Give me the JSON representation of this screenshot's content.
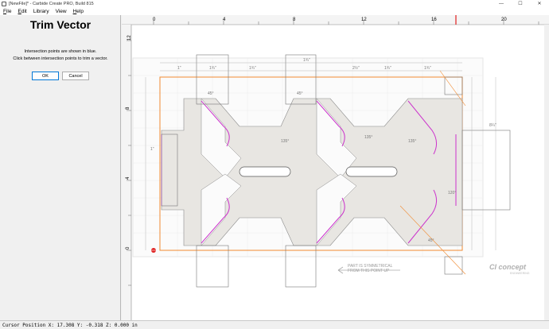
{
  "window": {
    "title": "[NewFile]* - Carbide Create PRO, Build 815",
    "minimize": "—",
    "maximize": "☐",
    "close": "✕"
  },
  "menu": [
    {
      "label": "File",
      "accel": "F",
      "rest": "ile"
    },
    {
      "label": "Edit",
      "accel": "E",
      "rest": "dit"
    },
    {
      "label": "Library",
      "accel": "",
      "rest": "Library"
    },
    {
      "label": "View",
      "accel": "",
      "rest": "View"
    },
    {
      "label": "Help",
      "accel": "H",
      "rest": "elp"
    }
  ],
  "panel": {
    "title": "Trim Vector",
    "line1": "Intersection points are shown in blue.",
    "line2": "Click between intersection points to trim a vector.",
    "ok_label": "OK",
    "cancel_label": "Cancel"
  },
  "ruler": {
    "top_labels": [
      "0",
      "4",
      "8",
      "12",
      "16",
      "20"
    ],
    "left_labels": [
      "12",
      "8",
      "4",
      "0"
    ],
    "cursor_marker_color": "#e02020"
  },
  "drawing": {
    "stock_border_color": "#f08a30",
    "vector_color": "#555555",
    "trim_highlight_color": "#cc33cc",
    "fill_color": "#e8e6e2",
    "angle_labels": [
      "45°",
      "45°",
      "135°",
      "135°",
      "135°",
      "45°",
      "120°"
    ],
    "dim_labels": [
      "1\"",
      "1¾\"",
      "1¾\"",
      "1¾\"",
      "2½\"",
      "1¾\"",
      "1¾\"",
      "1\"",
      "8¼\""
    ],
    "note_text": [
      "PART IS SYMMETRICAL",
      "FROM THIS POINT UP"
    ],
    "logo_text": "CI concept",
    "logo_subtext": "ENGINEERING"
  },
  "status": {
    "text": "Cursor Position X: 17.308 Y: -0.318 Z: 0.000 in"
  }
}
